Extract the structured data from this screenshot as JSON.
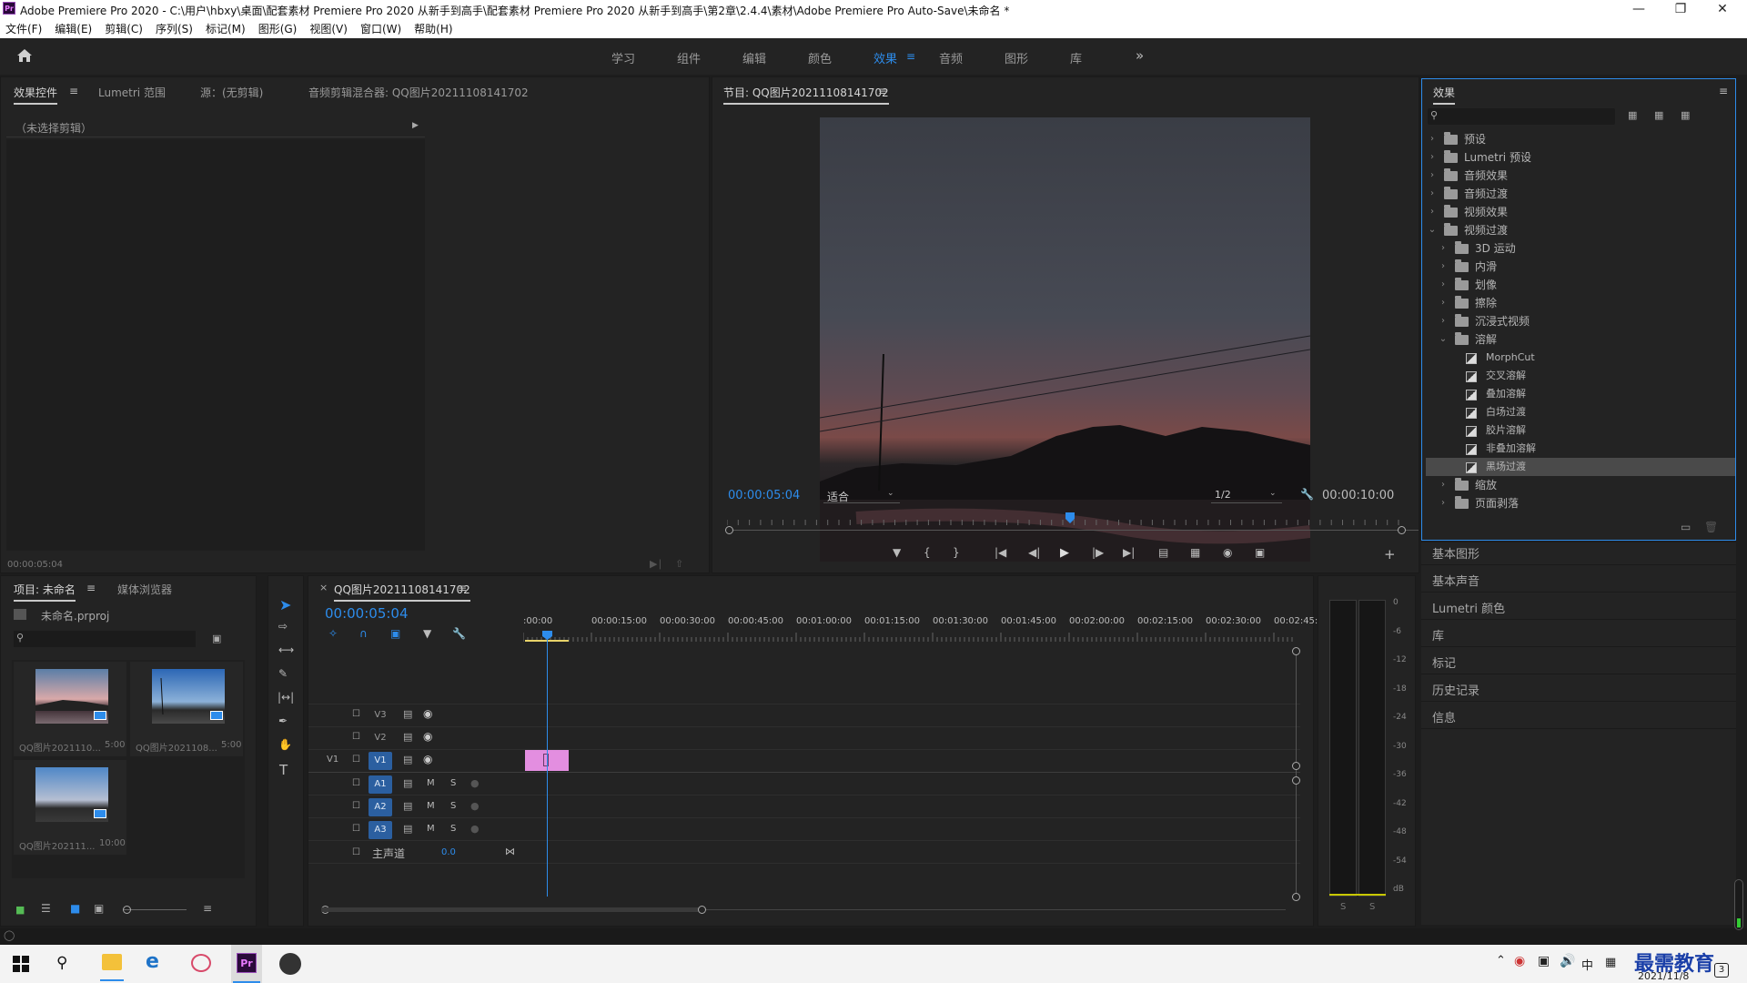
{
  "window": {
    "title": "Adobe Premiere Pro 2020 - C:\\用户\\hbxy\\桌面\\配套素材 Premiere Pro 2020 从新手到高手\\配套素材 Premiere Pro 2020 从新手到高手\\第2章\\2.4.4\\素材\\Adobe Premiere Pro Auto-Save\\未命名 *",
    "app_icon": "Pr"
  },
  "menu": [
    "文件(F)",
    "编辑(E)",
    "剪辑(C)",
    "序列(S)",
    "标记(M)",
    "图形(G)",
    "视图(V)",
    "窗口(W)",
    "帮助(H)"
  ],
  "workspaces": [
    "学习",
    "组件",
    "编辑",
    "颜色",
    "效果",
    "音频",
    "图形",
    "库"
  ],
  "active_workspace": "效果",
  "source_panel": {
    "tabs": [
      "效果控件",
      "Lumetri 范围",
      "源：(无剪辑)",
      "音频剪辑混合器: QQ图片20211108141702"
    ],
    "no_clip": "（未选择剪辑）",
    "timecode": "00:00:05:04"
  },
  "program_monitor": {
    "title": "节目: QQ图片20211108141702",
    "timecode": "00:00:05:04",
    "fit": "适合",
    "resolution": "1/2",
    "duration": "00:00:10:00",
    "playhead_fraction": 0.51
  },
  "effects_panel": {
    "title": "效果",
    "items": [
      {
        "label": "预设",
        "level": 0,
        "kind": "folder-special",
        "open": false
      },
      {
        "label": "Lumetri 预设",
        "level": 0,
        "kind": "folder-special",
        "open": false
      },
      {
        "label": "音频效果",
        "level": 0,
        "kind": "folder",
        "open": false
      },
      {
        "label": "音频过渡",
        "level": 0,
        "kind": "folder",
        "open": false
      },
      {
        "label": "视频效果",
        "level": 0,
        "kind": "folder",
        "open": false
      },
      {
        "label": "视频过渡",
        "level": 0,
        "kind": "folder",
        "open": true
      },
      {
        "label": "3D 运动",
        "level": 1,
        "kind": "folder",
        "open": false
      },
      {
        "label": "内滑",
        "level": 1,
        "kind": "folder",
        "open": false
      },
      {
        "label": "划像",
        "level": 1,
        "kind": "folder",
        "open": false
      },
      {
        "label": "擦除",
        "level": 1,
        "kind": "folder",
        "open": false
      },
      {
        "label": "沉浸式视频",
        "level": 1,
        "kind": "folder",
        "open": false
      },
      {
        "label": "溶解",
        "level": 1,
        "kind": "folder",
        "open": true
      },
      {
        "label": "MorphCut",
        "level": 2,
        "kind": "effect"
      },
      {
        "label": "交叉溶解",
        "level": 2,
        "kind": "effect"
      },
      {
        "label": "叠加溶解",
        "level": 2,
        "kind": "effect"
      },
      {
        "label": "白场过渡",
        "level": 2,
        "kind": "effect"
      },
      {
        "label": "胶片溶解",
        "level": 2,
        "kind": "effect"
      },
      {
        "label": "非叠加溶解",
        "level": 2,
        "kind": "effect"
      },
      {
        "label": "黑场过渡",
        "level": 2,
        "kind": "effect",
        "selected": true
      },
      {
        "label": "缩放",
        "level": 1,
        "kind": "folder",
        "open": false
      },
      {
        "label": "页面剥落",
        "level": 1,
        "kind": "folder",
        "open": false
      }
    ]
  },
  "side_panels": [
    "基本图形",
    "基本声音",
    "Lumetri 颜色",
    "库",
    "标记",
    "历史记录",
    "信息"
  ],
  "project_panel": {
    "tabs": [
      "项目: 未命名",
      "媒体浏览器"
    ],
    "project_file": "未命名.prproj",
    "clips": [
      {
        "name": "QQ图片2021110...",
        "duration": "5:00"
      },
      {
        "name": "QQ图片2021108...",
        "duration": "5:00"
      },
      {
        "name": "QQ图片202111...",
        "duration": "10:00"
      }
    ]
  },
  "timeline": {
    "tab": "QQ图片20211108141702",
    "timecode": "00:00:05:04",
    "ruler": [
      ":00:00",
      "00:00:15:00",
      "00:00:30:00",
      "00:00:45:00",
      "00:01:00:00",
      "00:01:15:00",
      "00:01:30:00",
      "00:01:45:00",
      "00:02:00:00",
      "00:02:15:00",
      "00:02:30:00",
      "00:02:45:"
    ],
    "video_tracks": [
      "V3",
      "V2",
      "V1"
    ],
    "audio_tracks": [
      "A1",
      "A2",
      "A3"
    ],
    "source_patch": "V1",
    "master_label": "主声道",
    "master_value": "0.0",
    "m_label": "M",
    "s_label": "S"
  },
  "audio_meter": {
    "scale": [
      "0",
      "-6",
      "-12",
      "-18",
      "-24",
      "-30",
      "-36",
      "-42",
      "-48",
      "-54",
      "dB"
    ],
    "solo": [
      "S",
      "S"
    ]
  },
  "taskbar": {
    "ime": "中",
    "date": "2021/11/8",
    "watermark": "最需教育",
    "badge": "3"
  },
  "colors": {
    "accent": "#2d8ceb",
    "clip": "#e38ee0",
    "panel": "#232323",
    "bg": "#1d1d1d"
  }
}
